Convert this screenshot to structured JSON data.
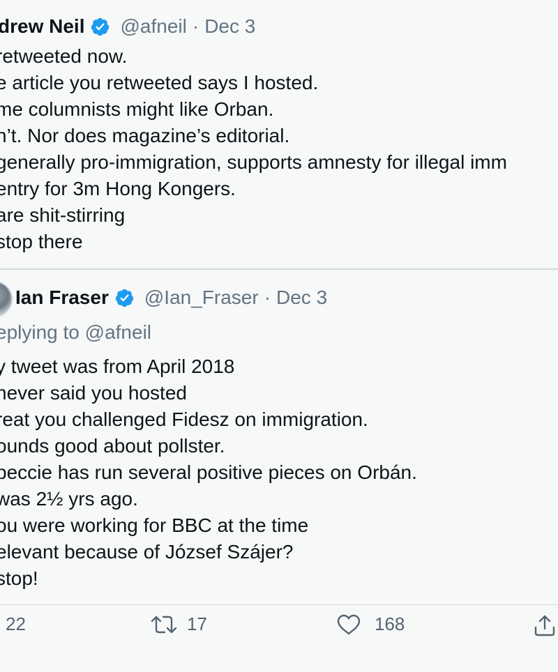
{
  "tweet1": {
    "name": "drew Neil",
    "handle": "@afneil",
    "separator": "·",
    "date": "Dec 3",
    "lines": [
      " retweeted now.",
      "e article you retweeted says I hosted.",
      "me columnists might like Orban.",
      "n’t. Nor does magazine’s editorial.",
      " generally pro-immigration, supports amnesty for illegal imm",
      "entry for 3m Hong Kongers.",
      " are shit-stirring",
      "stop there"
    ]
  },
  "tweet2": {
    "name": "Ian Fraser",
    "handle": "@Ian_Fraser",
    "separator": "·",
    "date": "Dec 3",
    "replying_prefix": "eplying to",
    "replying_handle": "@afneil",
    "lines": [
      "y tweet was from April 2018",
      "never said you hosted",
      "reat you challenged Fidesz on immigration.",
      "ounds good about pollster.",
      "peccie has run several positive pieces on Orbán.",
      "was 2½ yrs ago.",
      "ou were working for BBC at the time",
      "elevant because of József Szájer?",
      " stop!"
    ],
    "actions": {
      "reply_count": "22",
      "retweet_count": "17",
      "like_count": "168"
    }
  },
  "icons": {
    "verified": "verified-badge-icon",
    "retweet": "retweet-icon",
    "like": "heart-icon",
    "share": "share-icon"
  },
  "colors": {
    "verified": "#1d9bf0",
    "secondary_text": "#627482",
    "divider": "#d4dadf",
    "background": "#f7f8f8"
  }
}
